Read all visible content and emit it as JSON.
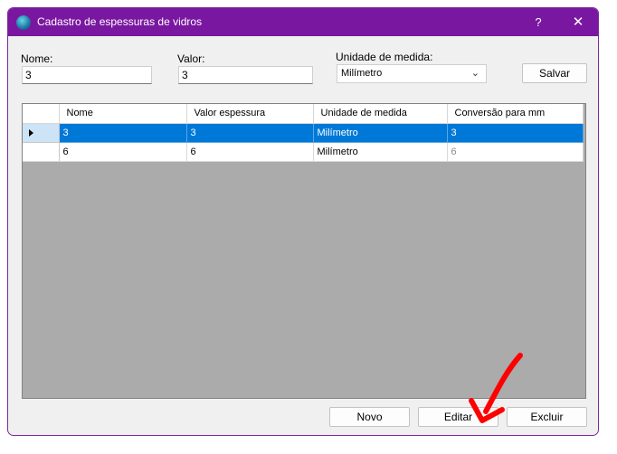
{
  "window": {
    "title": "Cadastro de espessuras de vidros",
    "help_label": "?",
    "close_label": "✕"
  },
  "form": {
    "nome_label": "Nome:",
    "nome_value": "3",
    "valor_label": "Valor:",
    "valor_value": "3",
    "unidade_label": "Unidade de medida:",
    "unidade_value": "Milímetro",
    "save_label": "Salvar"
  },
  "grid": {
    "columns": [
      "Nome",
      "Valor espessura",
      "Unidade de medida",
      "Conversão para mm"
    ],
    "rows": [
      {
        "nome": "3",
        "valor": "3",
        "unidade": "Milímetro",
        "conversao": "3",
        "selected": true
      },
      {
        "nome": "6",
        "valor": "6",
        "unidade": "Milímetro",
        "conversao": "6",
        "selected": false
      }
    ]
  },
  "actions": {
    "novo_label": "Novo",
    "editar_label": "Editar",
    "excluir_label": "Excluir"
  },
  "colors": {
    "titlebar": "#7a17a0",
    "selection": "#0078d7",
    "annotation_arrow": "#ff0000"
  }
}
